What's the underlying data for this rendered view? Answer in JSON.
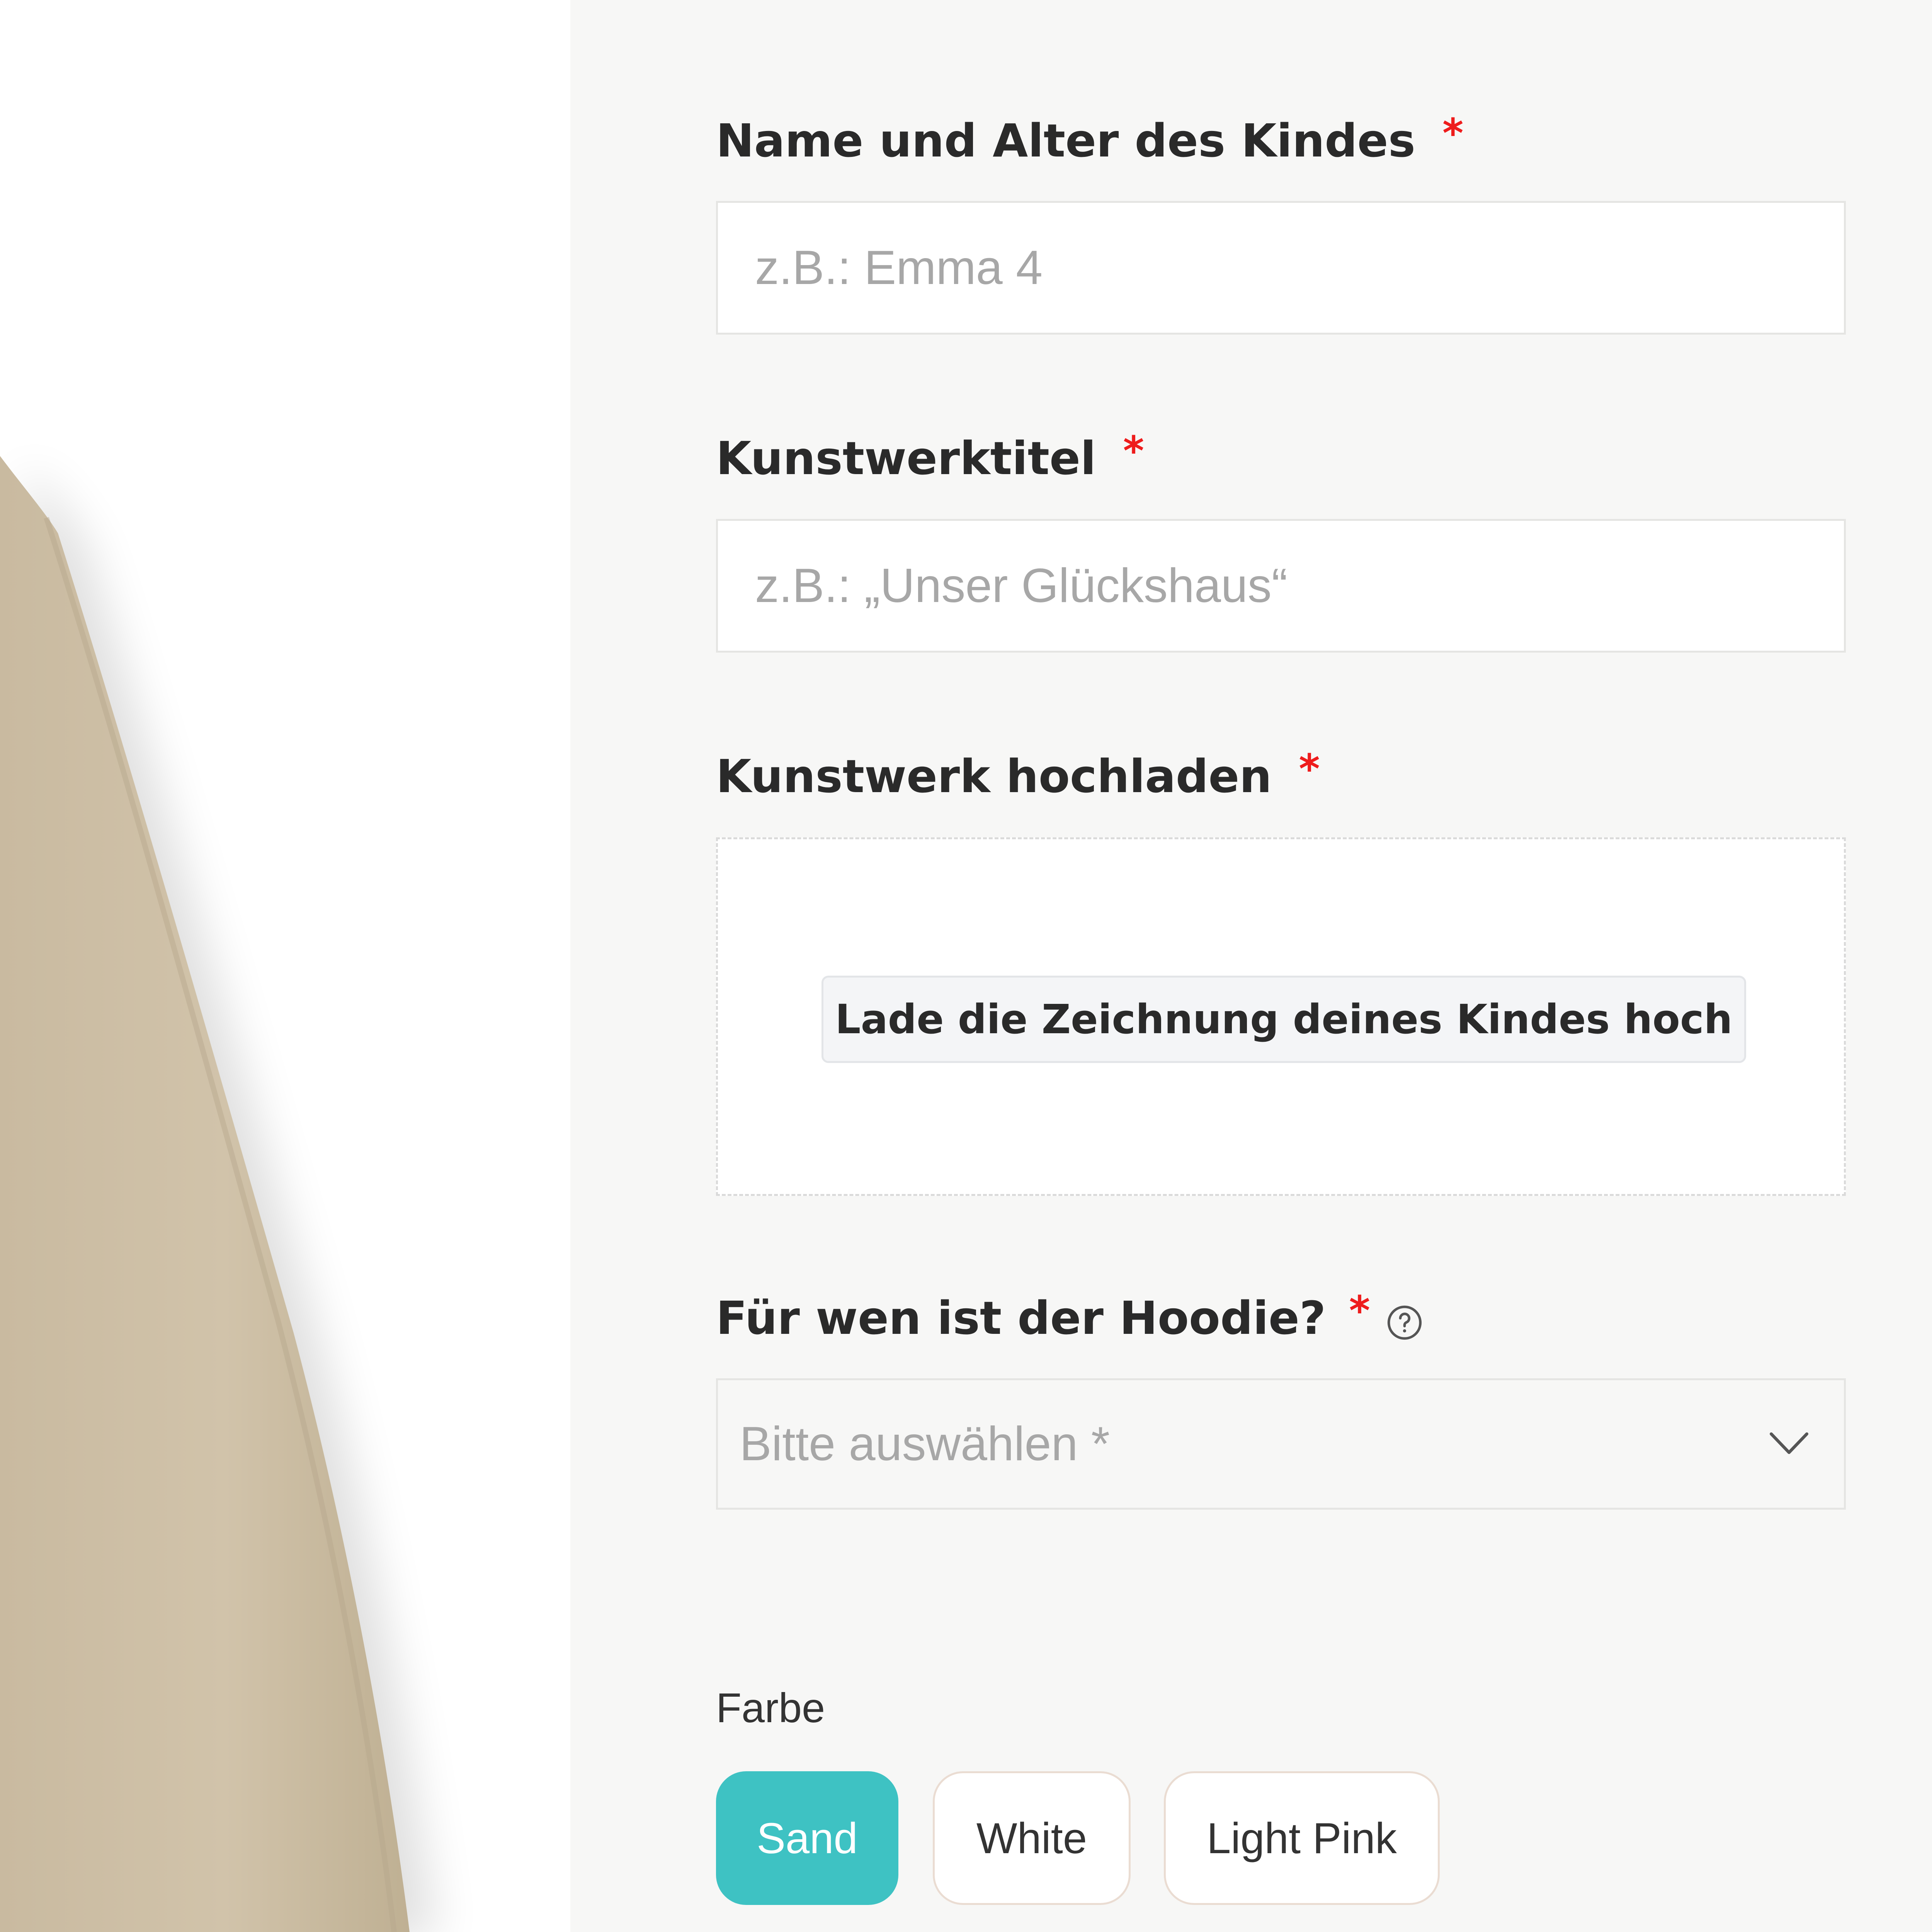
{
  "form": {
    "child_name_label": "Name und Alter des Kindes",
    "child_name_placeholder": "z.B.: Emma 4",
    "artwork_title_label": "Kunstwerktitel",
    "artwork_title_placeholder": "z.B.: „Unser Glückshaus“",
    "upload_label": "Kunstwerk hochladen",
    "upload_button": "Lade die Zeichnung deines Kindes hoch",
    "recipient_label": "Für wen ist der Hoodie?",
    "recipient_placeholder": "Bitte auswählen *",
    "required_marker": "*"
  },
  "color": {
    "label": "Farbe",
    "options": [
      "Sand",
      "White",
      "Light Pink"
    ],
    "selected": "Sand"
  },
  "icons": {
    "help": "question-circle-icon",
    "dropdown": "chevron-down-icon"
  },
  "colors": {
    "accent": "#3ec2c3",
    "required": "#ee1c1c",
    "product_sand": "#cdbfa6"
  }
}
